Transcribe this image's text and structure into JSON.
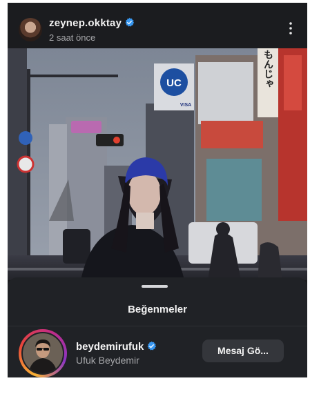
{
  "post": {
    "username": "zeynep.okktay",
    "time_ago": "2 saat önce"
  },
  "photo": {
    "signs": {
      "uc_logo": "UC",
      "visa": "VISA",
      "side_sign": "もんじゃ"
    }
  },
  "likes_sheet": {
    "title": "Beğenmeler",
    "liker": {
      "username": "beydemirufuk",
      "full_name": "Ufuk Beydemir",
      "message_button": "Mesaj Gö..."
    }
  },
  "colors": {
    "background": "#1b1c1f",
    "sheet": "#202226",
    "verified": "#3897f0",
    "button": "#34363b"
  },
  "icons": [
    "verified-badge-icon",
    "more-options-icon"
  ]
}
